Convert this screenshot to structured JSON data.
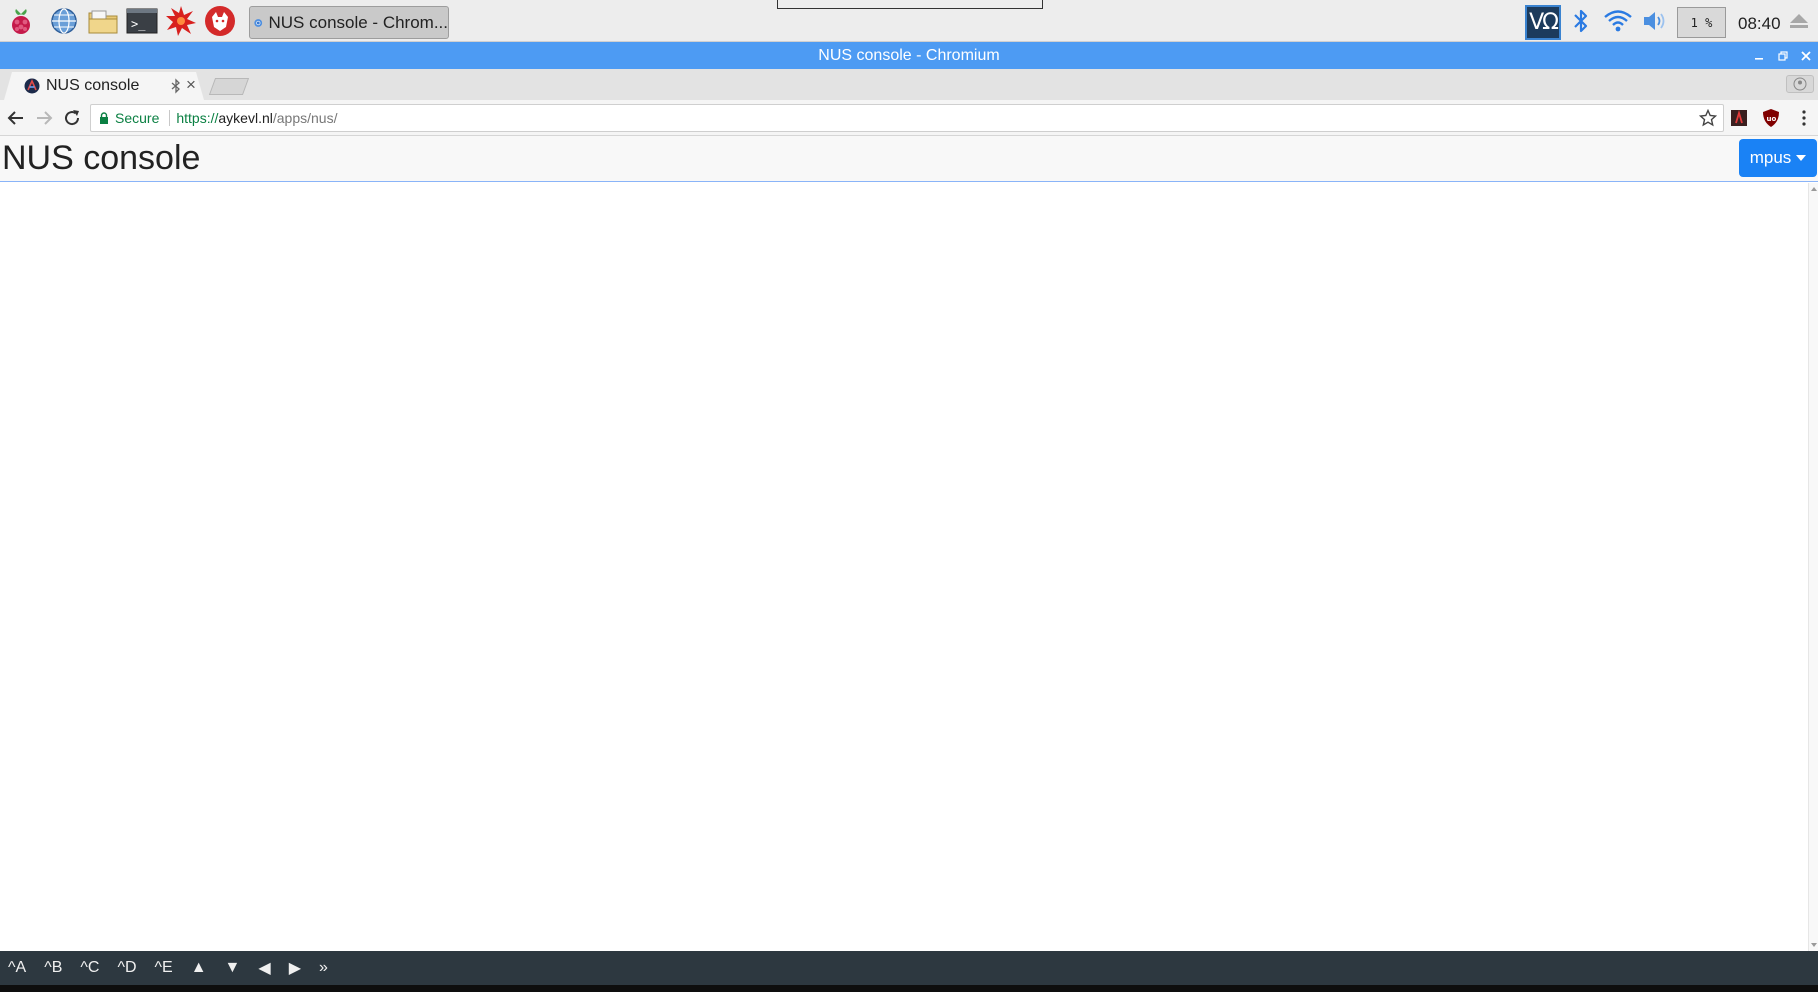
{
  "taskbar": {
    "launchers": [
      "raspberry-menu-icon",
      "web-browser-icon",
      "file-manager-icon",
      "terminal-icon",
      "mathematica-icon",
      "wolfram-icon"
    ],
    "task_button_label": "NUS console - Chrom...",
    "vnc_label": "VΩ",
    "cpu_usage": "1 %",
    "clock": "08:40"
  },
  "window": {
    "title": "NUS console - Chromium"
  },
  "tabs": [
    {
      "label": "NUS console",
      "close": "×"
    }
  ],
  "toolbar": {
    "secure_label": "Secure",
    "url_scheme": "https://",
    "url_host": "aykevl.nl",
    "url_path": "/apps/nus/"
  },
  "page": {
    "title": "NUS console",
    "device_dropdown_label": "mpus"
  },
  "keybar": {
    "keys": [
      "^A",
      "^B",
      "^C",
      "^D",
      "^E",
      "▲",
      "▼",
      "◀",
      "▶",
      "»"
    ]
  },
  "colors": {
    "titlebar": "#4d9bf3",
    "dropdown": "#1a82f5",
    "secure_green": "#0b8043",
    "keybar": "#2d3840"
  }
}
